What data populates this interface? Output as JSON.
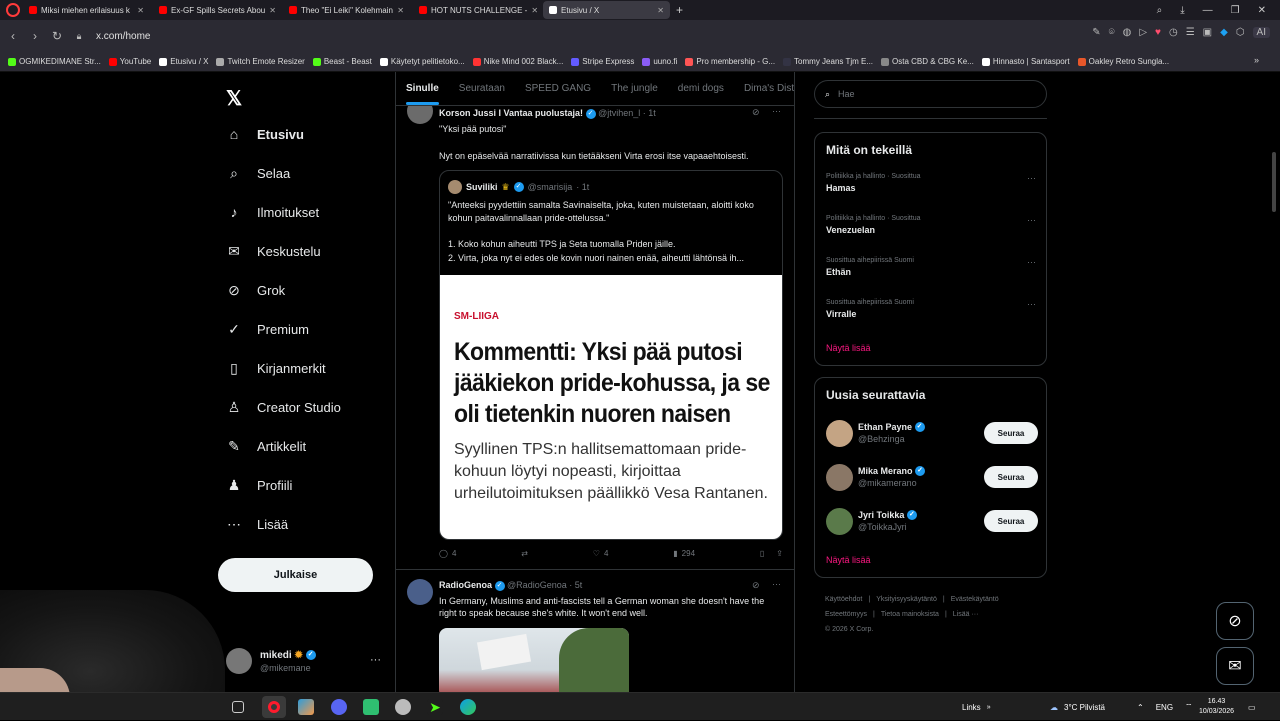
{
  "browser": {
    "tabs": [
      {
        "title": "Miksi miehen erilaisuus k",
        "color": "#ff0000",
        "active": false
      },
      {
        "title": "Ex-GF Spills Secrets Abou",
        "color": "#ff0000",
        "active": false
      },
      {
        "title": "Theo \"Ei Leiki\" Kolehmain",
        "color": "#ff0000",
        "active": false
      },
      {
        "title": "HOT NUTS CHALLENGE -",
        "color": "#ff0000",
        "active": false
      },
      {
        "title": "Etusivu / X",
        "color": "#ffffff",
        "active": true
      }
    ],
    "url": "x.com/home",
    "bookmarks": [
      {
        "label": "OGMIKEDIMANE Str...",
        "color": "#53fc18"
      },
      {
        "label": "YouTube",
        "color": "#ff0000"
      },
      {
        "label": "Etusivu / X",
        "color": "#ffffff"
      },
      {
        "label": "Twitch Emote Resizer",
        "color": "#aaaaaa"
      },
      {
        "label": "Beast - Beast",
        "color": "#53fc18"
      },
      {
        "label": "Käytetyt pelitietoko...",
        "color": "#ffffff"
      },
      {
        "label": "Nike Mind 002 Black...",
        "color": "#ff3333"
      },
      {
        "label": "Stripe Express",
        "color": "#635bff"
      },
      {
        "label": "uuno.fi",
        "color": "#8a5cf6"
      },
      {
        "label": "Pro membership - G...",
        "color": "#ff5555"
      },
      {
        "label": "Tommy Jeans Tjm E...",
        "color": "#333344"
      },
      {
        "label": "Osta CBD & CBG Ke...",
        "color": "#888888"
      },
      {
        "label": "Hinnasto | Santasport",
        "color": "#ffffff"
      },
      {
        "label": "Oakley Retro Sungla...",
        "color": "#e8572a"
      }
    ]
  },
  "nav": {
    "items": [
      {
        "label": "Etusivu",
        "icon": "home-icon",
        "glyph": "⌂"
      },
      {
        "label": "Selaa",
        "icon": "search-icon",
        "glyph": "⌕"
      },
      {
        "label": "Ilmoitukset",
        "icon": "bell-icon",
        "glyph": "♪"
      },
      {
        "label": "Keskustelu",
        "icon": "mail-icon",
        "glyph": "✉"
      },
      {
        "label": "Grok",
        "icon": "grok-icon",
        "glyph": "⊘"
      },
      {
        "label": "Premium",
        "icon": "premium-icon",
        "glyph": "✓"
      },
      {
        "label": "Kirjanmerkit",
        "icon": "bookmark-icon",
        "glyph": "▯"
      },
      {
        "label": "Creator Studio",
        "icon": "creator-studio-icon",
        "glyph": "♙"
      },
      {
        "label": "Artikkelit",
        "icon": "articles-icon",
        "glyph": "✎"
      },
      {
        "label": "Profiili",
        "icon": "profile-icon",
        "glyph": "♟"
      },
      {
        "label": "Lisää",
        "icon": "more-icon",
        "glyph": "⋯"
      }
    ],
    "post_button": "Julkaise",
    "profile": {
      "name": "mikedi",
      "handle": "@mikemane"
    }
  },
  "feed": {
    "tabs": [
      "Sinulle",
      "Seurataan",
      "SPEED GANG",
      "The jungle",
      "demi dogs",
      "Dima's Dist"
    ],
    "post1": {
      "author": "Korson Jussi I Vantaa puolustaja!",
      "handle": "@jtvihen_l",
      "time": "· 1t",
      "line1": "\"Yksi pää putosi\"",
      "line2": "Nyt on epäselvää narratiivissa kun tietääkseni Virta erosi itse vapaaehtoisesti.",
      "quote": {
        "author": "Suviliki",
        "handle": "@smarisija",
        "time": "· 1t",
        "text1": "\"Anteeksi pyydettiin samalta Savinaiselta, joka, kuten muistetaan, aloitti koko kohun paitavalinnallaan pride-ottelussa.\"",
        "text2": "1. Koko kohun aiheutti TPS ja Seta tuomalla Priden jäille.",
        "text3": "2. Virta, joka nyt ei edes ole kovin nuori nainen enää, aiheutti lähtönsä ih..."
      },
      "article": {
        "kicker": "SM-LIIGA",
        "headline": "Kommentti: Yksi pää putosi jääkiekon pride-kohussa, ja se oli tietenkin nuoren naisen",
        "lede": "Syyllinen TPS:n hallitsemattomaan pride-kohuun löytyi nopeasti, kirjoittaa urheilutoimituksen päällikkö Vesa Rantanen."
      },
      "replies": "4",
      "likes": "4",
      "views": "294"
    },
    "post2": {
      "author": "RadioGenoa",
      "handle": "@RadioGenoa",
      "time": "· 5t",
      "text": "In Germany, Muslims and anti-fascists tell a German woman she doesn't have the right to speak because she's white. It won't end well."
    }
  },
  "sidebar": {
    "search_placeholder": "Hae",
    "trends_title": "Mitä on tekeillä",
    "trends": [
      {
        "category": "Politiikka ja hallinto · Suosittua",
        "name": "Hamas"
      },
      {
        "category": "Politiikka ja hallinto · Suosittua",
        "name": "Venezuelan"
      },
      {
        "category": "Suosittua aihepiirissä Suomi",
        "name": "Ethän"
      },
      {
        "category": "Suosittua aihepiirissä Suomi",
        "name": "Virralle"
      }
    ],
    "trends_more": "Näytä lisää",
    "follow_title": "Uusia seurattavia",
    "follow": [
      {
        "name": "Ethan Payne",
        "handle": "@Behzinga",
        "button": "Seuraa"
      },
      {
        "name": "Mika Merano",
        "handle": "@mikamerano",
        "button": "Seuraa"
      },
      {
        "name": "Jyri Toikka",
        "handle": "@ToikkaJyri",
        "button": "Seuraa"
      }
    ],
    "follow_more": "Näytä lisää",
    "footer_links": [
      "Käyttöehdot",
      "Yksityisyyskäytäntö",
      "Evästekäytäntö",
      "Esteettömyys",
      "Tietoa mainoksista",
      "Lisää ···"
    ],
    "copyright": "© 2026 X Corp."
  },
  "taskbar": {
    "links": "Links",
    "weather": "3°C Pilvistä",
    "lang": "ENG",
    "time": "16.43",
    "date": "10/03/2026"
  },
  "colors": {
    "accent": "#1d9bf0",
    "pink": "#f91880",
    "article_red": "#c8102e"
  }
}
